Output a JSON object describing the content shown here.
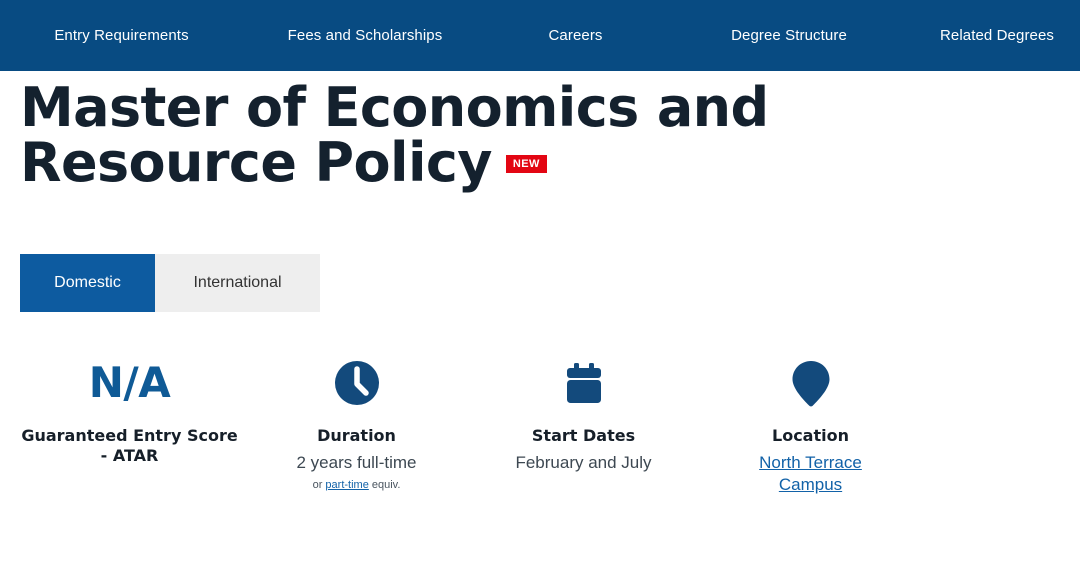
{
  "nav": {
    "items": [
      {
        "label": "Entry Requirements"
      },
      {
        "label": "Fees and Scholarships"
      },
      {
        "label": "Careers"
      },
      {
        "label": "Degree Structure"
      },
      {
        "label": "Related Degrees"
      }
    ],
    "background_color": "#084b82"
  },
  "header": {
    "title": "Master of Economics and Resource Policy",
    "badge": "NEW",
    "badge_color": "#e30613",
    "title_color": "#14212e"
  },
  "tabs": {
    "items": [
      {
        "label": "Domestic",
        "active": true
      },
      {
        "label": "International",
        "active": false
      }
    ],
    "active_color": "#0d5ba0",
    "inactive_color": "#eeeeee"
  },
  "cards": [
    {
      "icon": "none",
      "value_big": "N/A",
      "label": "Guaranteed Entry Score - ATAR",
      "value": "",
      "sub": ""
    },
    {
      "icon": "clock-icon",
      "value_big": "",
      "label": "Duration",
      "value": "2 years full-time",
      "sub_prefix": "or ",
      "sub_link": "part-time",
      "sub_suffix": " equiv."
    },
    {
      "icon": "calendar-icon",
      "value_big": "",
      "label": "Start Dates",
      "value": "February and July",
      "sub": ""
    },
    {
      "icon": "map-pin-icon",
      "value_big": "",
      "label": "Location",
      "value_link": "North Terrace Campus",
      "sub": ""
    }
  ],
  "colors": {
    "icon_blue": "#134a7c",
    "link_blue": "#1262a8"
  }
}
